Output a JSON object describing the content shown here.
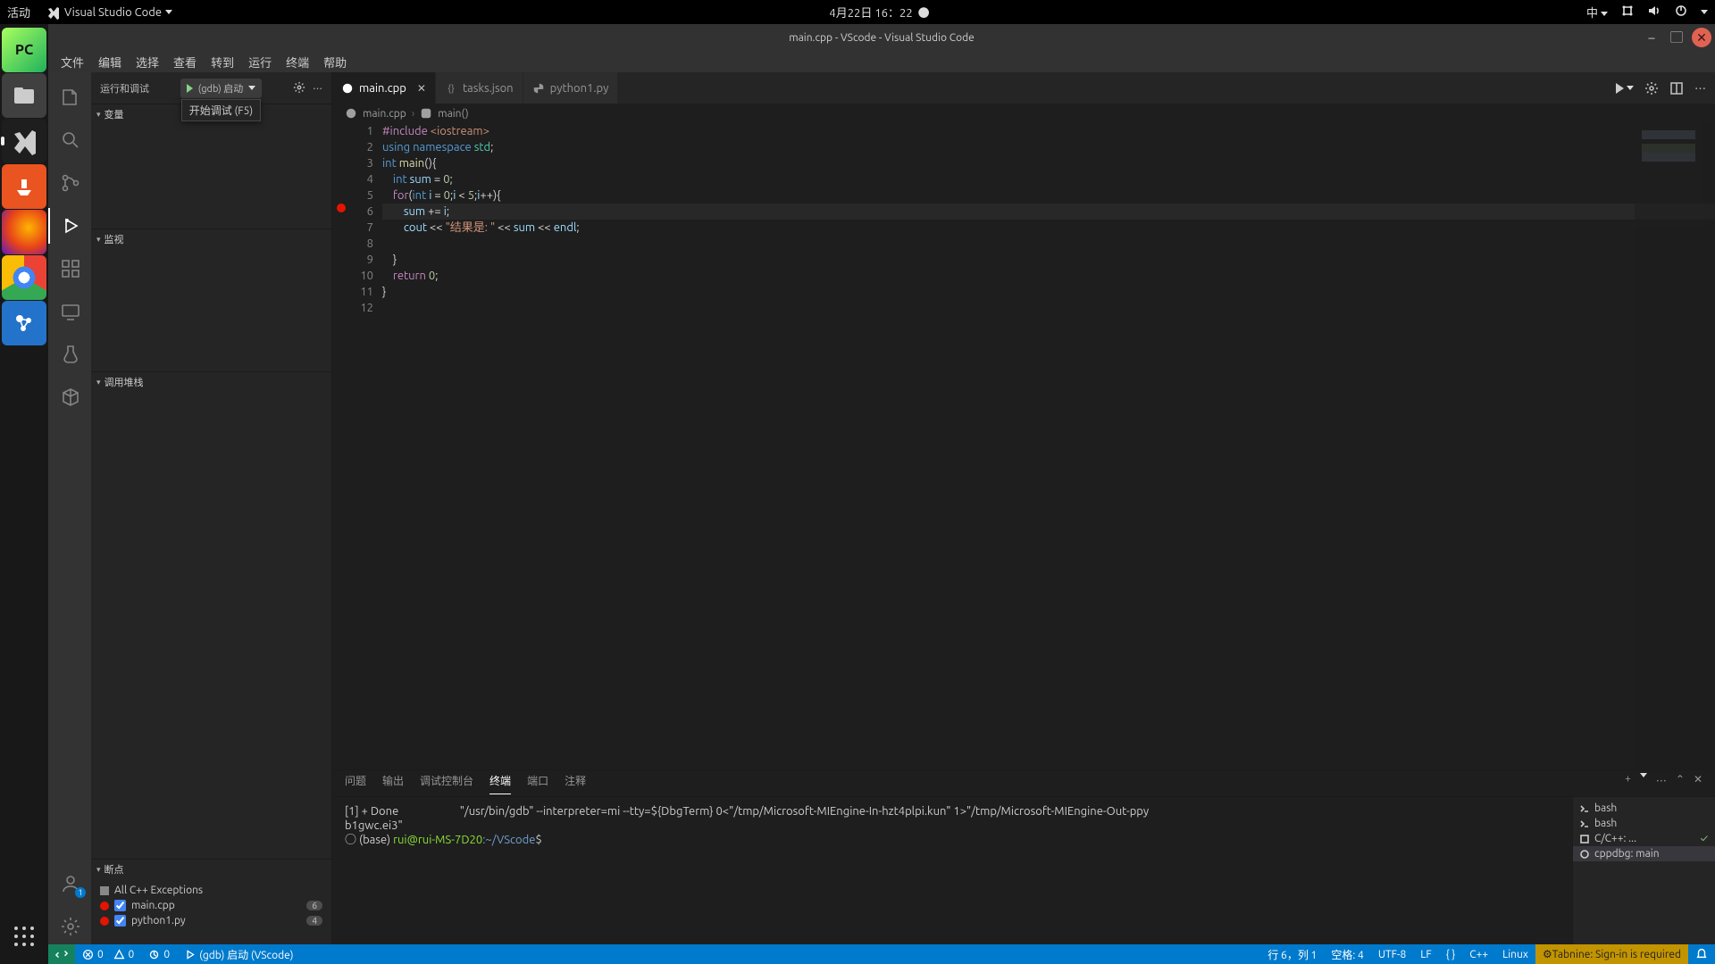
{
  "topbar": {
    "activities": "活动",
    "app": "Visual Studio Code",
    "clock": "4月22日 16：22",
    "ime": "中"
  },
  "title": "main.cpp - VScode - Visual Studio Code",
  "menu": {
    "file": "文件",
    "edit": "编辑",
    "select": "选择",
    "view": "查看",
    "goto": "转到",
    "run": "运行",
    "terminal": "终端",
    "help": "帮助"
  },
  "sidebar": {
    "title": "运行和调试",
    "config_label": "(gdb) 启动",
    "tooltip": "开始调试 (F5)",
    "sections": {
      "variables": "变量",
      "watch": "监视",
      "callstack": "调用堆栈",
      "breakpoints": "断点"
    },
    "breakpoints": {
      "exceptions": {
        "label": "All C++ Exceptions",
        "checked": false
      },
      "items": [
        {
          "file": "main.cpp",
          "count": "6"
        },
        {
          "file": "python1.py",
          "count": "4"
        }
      ]
    }
  },
  "tabs": [
    {
      "name": "main.cpp",
      "kind": "cpp",
      "active": true,
      "close": true
    },
    {
      "name": "tasks.json",
      "kind": "json",
      "active": false,
      "close": false
    },
    {
      "name": "python1.py",
      "kind": "py",
      "active": false,
      "close": false
    }
  ],
  "breadcrumb": {
    "file": "main.cpp",
    "symbol": "main()"
  },
  "code": {
    "lines": 12,
    "breakpoint_line": 6,
    "current_line": 6,
    "content": [
      "#include <iostream>",
      "using namespace std;",
      "int main(){",
      "    int sum = 0;",
      "    for(int i = 0;i < 5;i++){",
      "        sum += i;",
      "        cout << \"结果是: \" << sum << endl;",
      "",
      "    }",
      "    return 0;",
      "}",
      ""
    ]
  },
  "panel": {
    "tabs": {
      "problems": "问题",
      "output": "输出",
      "debug": "调试控制台",
      "terminal": "终端",
      "ports": "端口",
      "comments": "注释"
    },
    "terminal": {
      "l1a": "[1] + Done",
      "l1b": "\"/usr/bin/gdb\" --interpreter=mi --tty=${DbgTerm} 0<\"/tmp/Microsoft-MIEngine-In-hzt4plpi.kun\" 1>\"/tmp/Microsoft-MIEngine-Out-ppy",
      "l1c": "b1gwc.ei3\"",
      "l2_bullet": "○ ",
      "l2_base": "(base) ",
      "l2_user": "rui@rui-MS-7D20",
      "l2_path": ":~/VScode",
      "l2_dollar": "$"
    },
    "termlist": {
      "bash1": "bash",
      "bash2": "bash",
      "cc": "C/C++: ...",
      "dbg": "cppdbg: main"
    }
  },
  "status": {
    "err": "0",
    "warn": "0",
    "ports": "0",
    "launch": "(gdb) 启动 (VScode)",
    "ln": "行 6，列 1",
    "spaces": "空格: 4",
    "enc": "UTF-8",
    "eol": "LF",
    "brace": "{ }",
    "lang": "C++",
    "os": "Linux",
    "tabnine": "Tabnine: Sign-in is required"
  }
}
